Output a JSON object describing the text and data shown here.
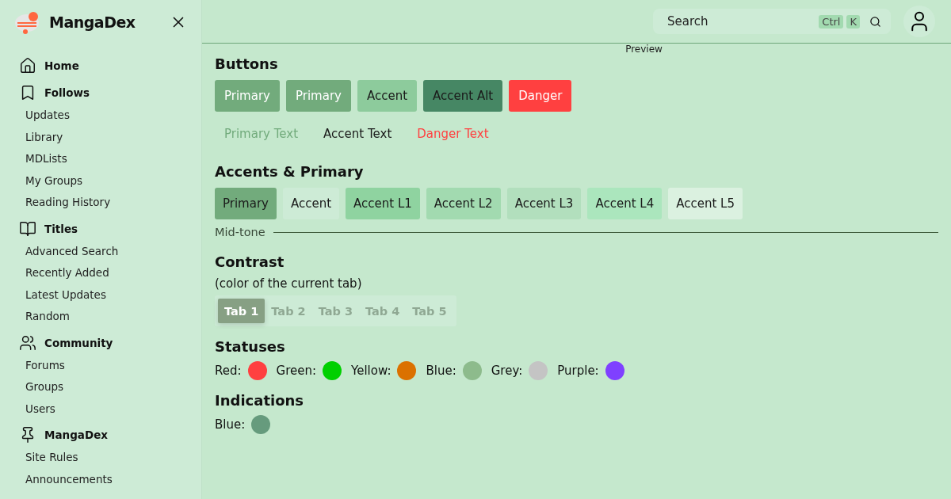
{
  "sidebar": {
    "logo": "MangaDex",
    "sections": [
      {
        "title": "Home"
      },
      {
        "title": "Follows",
        "items": [
          "Updates",
          "Library",
          "MDLists",
          "My Groups",
          "Reading History"
        ]
      },
      {
        "title": "Titles",
        "items": [
          "Advanced Search",
          "Recently Added",
          "Latest Updates",
          "Random"
        ]
      },
      {
        "title": "Community",
        "items": [
          "Forums",
          "Groups",
          "Users"
        ]
      },
      {
        "title": "MangaDex",
        "items": [
          "Site Rules",
          "Announcements"
        ]
      }
    ]
  },
  "header": {
    "search": {
      "placeholder": "Search",
      "keys": [
        "Ctrl",
        "K"
      ]
    }
  },
  "preview_title": "Preview",
  "buttons": {
    "title": "Buttons",
    "items": [
      {
        "label": "Primary",
        "kind": "primary"
      },
      {
        "label": "Primary",
        "kind": "primary"
      },
      {
        "label": "Accent",
        "kind": "accent"
      },
      {
        "label": "Accent Alt",
        "kind": "accent-alt"
      },
      {
        "label": "Danger",
        "kind": "danger"
      }
    ],
    "text_buttons": [
      {
        "label": "Primary Text",
        "kind": "primary"
      },
      {
        "label": "Accent Text",
        "kind": "accent"
      },
      {
        "label": "Danger Text",
        "kind": "danger"
      }
    ]
  },
  "accents": {
    "title": "Accents & Primary",
    "items": [
      {
        "label": "Primary",
        "color": "#72ab7c"
      },
      {
        "label": "Accent",
        "color": "#cdebd6"
      },
      {
        "label": "Accent L1",
        "color": "#8fd3a0"
      },
      {
        "label": "Accent L2",
        "color": "#a2dab0"
      },
      {
        "label": "Accent L3",
        "color": "#b2dfbd"
      },
      {
        "label": "Accent L4",
        "color": "#abe6bd"
      },
      {
        "label": "Accent L5",
        "color": "#dbf1e0"
      }
    ]
  },
  "midtone": "Mid-tone",
  "contrast": {
    "title": "Contrast",
    "note": "(color of the current tab)",
    "tabs": [
      {
        "label": "Tab 1",
        "selected": true
      },
      {
        "label": "Tab 2",
        "selected": false
      },
      {
        "label": "Tab 3",
        "selected": false
      },
      {
        "label": "Tab 4",
        "selected": false
      },
      {
        "label": "Tab 5",
        "selected": false
      }
    ]
  },
  "statuses": {
    "title": "Statuses",
    "items": [
      {
        "label": "Red:",
        "color": "#ff4040"
      },
      {
        "label": "Green:",
        "color": "#00d000"
      },
      {
        "label": "Yellow:",
        "color": "#db7100"
      },
      {
        "label": "Blue:",
        "color": "#8dbb8c"
      },
      {
        "label": "Grey:",
        "color": "#c4c4c4"
      },
      {
        "label": "Purple:",
        "color": "#7f40ff"
      }
    ]
  },
  "indications": {
    "title": "Indications",
    "items": [
      {
        "label": "Blue:",
        "color": "#669b7d"
      }
    ]
  }
}
